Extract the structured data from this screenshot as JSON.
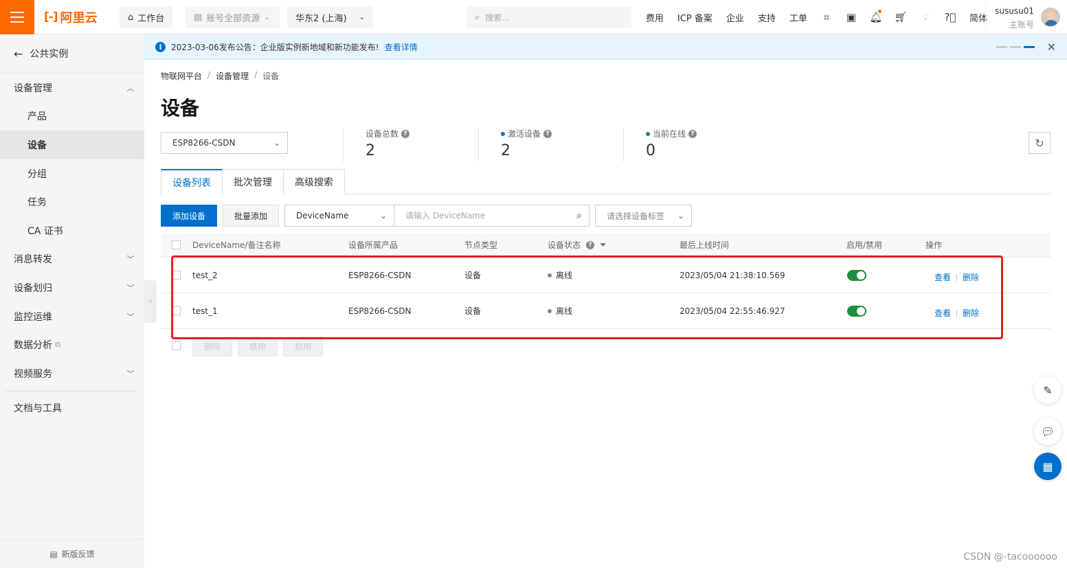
{
  "topbar": {
    "logo_text": "阿里云",
    "workbench": "工作台",
    "resources": "账号全部资源",
    "region": "华东2 (上海)",
    "search_placeholder": "搜索...",
    "links": [
      "费用",
      "ICP 备案",
      "企业",
      "支持",
      "工单"
    ],
    "lang": "简体",
    "username": "sususu01",
    "role": "主账号"
  },
  "notice": {
    "text": "2023-03-06发布公告：企业版实例新地域和新功能发布!",
    "link": "查看详情"
  },
  "sidebar": {
    "back": "公共实例",
    "items": [
      {
        "label": "设备管理",
        "type": "group"
      },
      {
        "label": "产品",
        "type": "sub"
      },
      {
        "label": "设备",
        "type": "sub-active"
      },
      {
        "label": "分组",
        "type": "sub"
      },
      {
        "label": "任务",
        "type": "sub"
      },
      {
        "label": "CA 证书",
        "type": "sub"
      },
      {
        "label": "消息转发",
        "type": "group"
      },
      {
        "label": "设备划归",
        "type": "group"
      },
      {
        "label": "监控运维",
        "type": "group"
      },
      {
        "label": "数据分析",
        "type": "group-ext"
      },
      {
        "label": "视频服务",
        "type": "group"
      }
    ],
    "docs": "文档与工具",
    "feedback": "新版反馈"
  },
  "breadcrumb": [
    "物联网平台",
    "设备管理",
    "设备"
  ],
  "page_title": "设备",
  "product_select": "ESP8266-CSDN",
  "stats": [
    {
      "label": "设备总数",
      "value": "2",
      "dot": ""
    },
    {
      "label": "激活设备",
      "value": "2",
      "dot": "#0070cc"
    },
    {
      "label": "当前在线",
      "value": "0",
      "dot": "#1e8e3e"
    }
  ],
  "tabs": [
    "设备列表",
    "批次管理",
    "高级搜索"
  ],
  "toolbar": {
    "add": "添加设备",
    "batch_add": "批量添加",
    "filter_field": "DeviceName",
    "filter_placeholder": "请输入 DeviceName",
    "tag_placeholder": "请选择设备标签"
  },
  "table": {
    "columns": [
      "DeviceName/备注名称",
      "设备所属产品",
      "节点类型",
      "设备状态",
      "最后上线时间",
      "启用/禁用",
      "操作"
    ],
    "rows": [
      {
        "name": "test_2",
        "product": "ESP8266-CSDN",
        "node": "设备",
        "status": "离线",
        "last_online": "2023/05/04 21:38:10.569",
        "view": "查看",
        "delete": "删除"
      },
      {
        "name": "test_1",
        "product": "ESP8266-CSDN",
        "node": "设备",
        "status": "离线",
        "last_online": "2023/05/04 22:55:46.927",
        "view": "查看",
        "delete": "删除"
      }
    ]
  },
  "bulk": [
    "删除",
    "禁用",
    "启用"
  ],
  "watermark": "CSDN @-tacoooooo",
  "colors": {
    "brand": "#ff6a00",
    "primary": "#0070cc",
    "enabled": "#1e8e3e",
    "highlight": "#e32020"
  }
}
